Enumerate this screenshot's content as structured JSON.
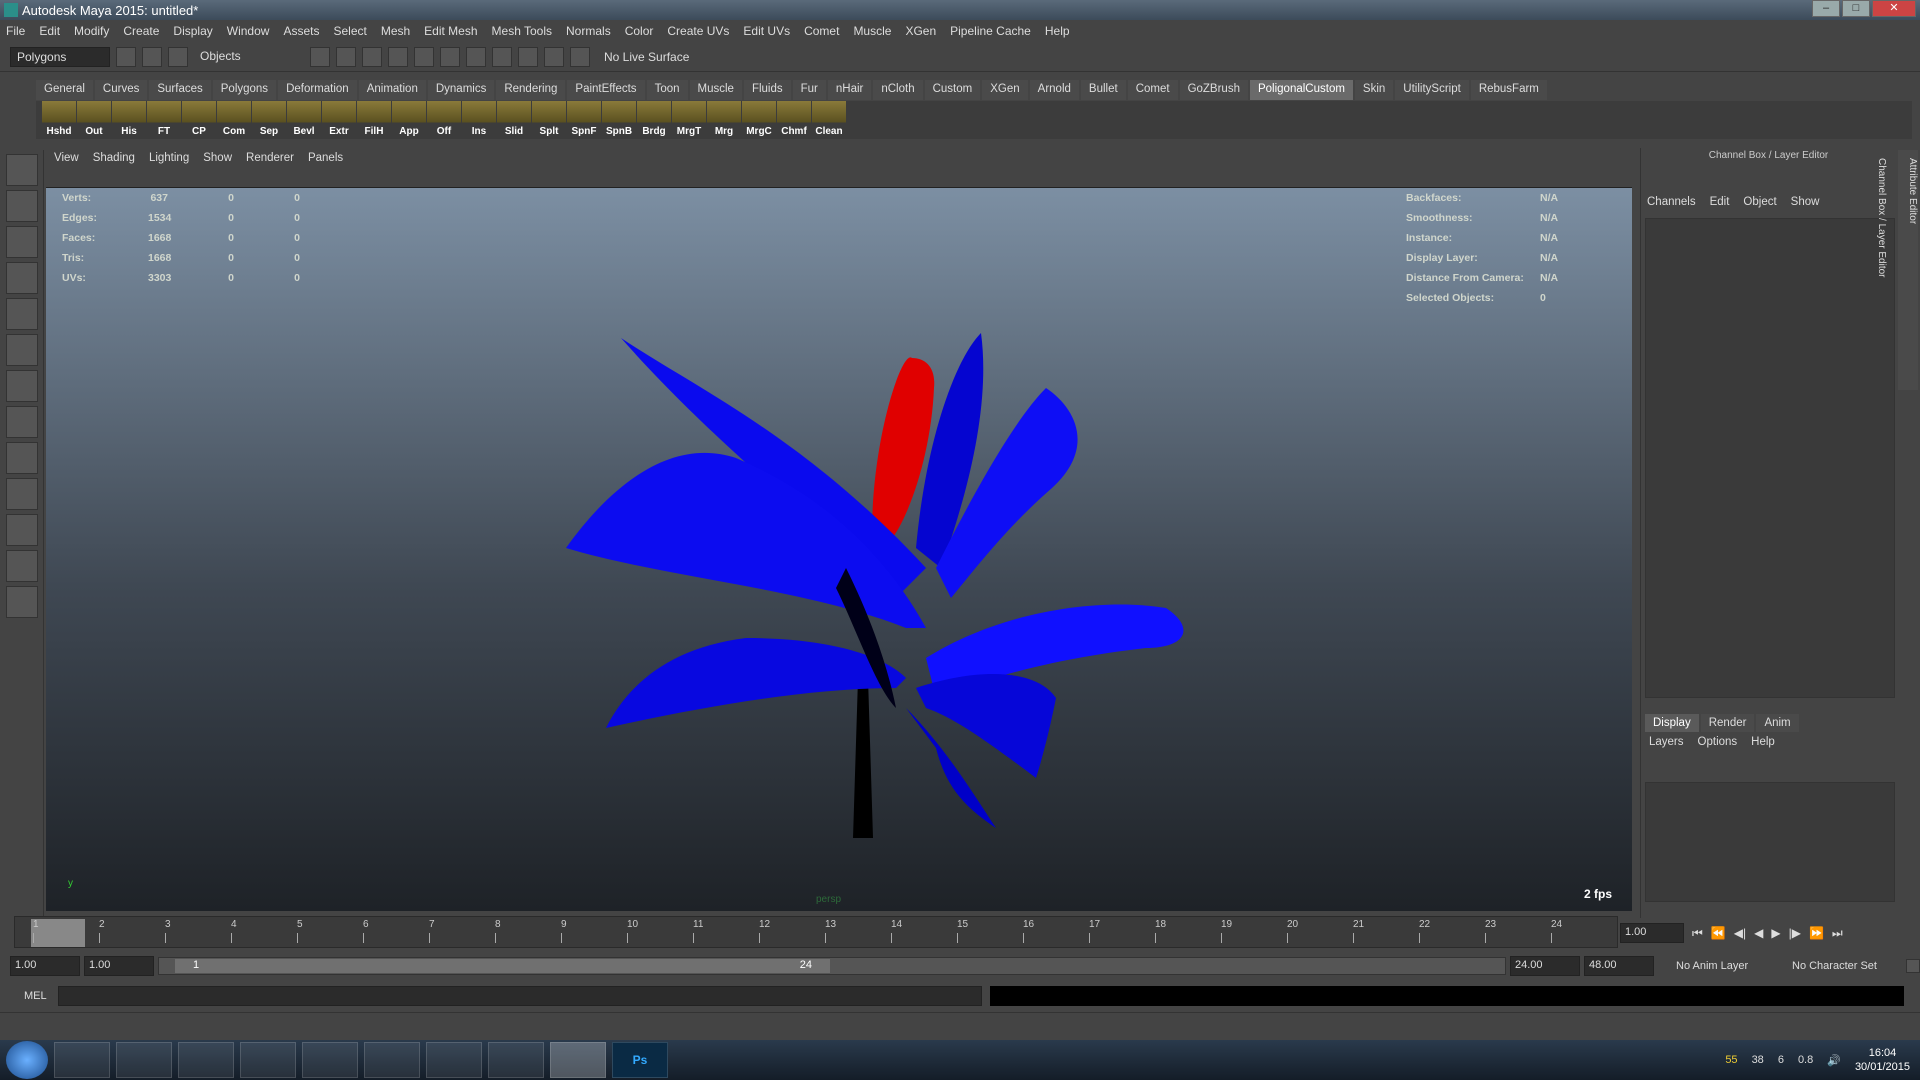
{
  "window": {
    "title": "Autodesk Maya 2015: untitled*"
  },
  "menubar": [
    "File",
    "Edit",
    "Modify",
    "Create",
    "Display",
    "Window",
    "Assets",
    "Select",
    "Mesh",
    "Edit Mesh",
    "Mesh Tools",
    "Normals",
    "Color",
    "Create UVs",
    "Edit UVs",
    "Comet",
    "Muscle",
    "XGen",
    "Pipeline Cache",
    "Help"
  ],
  "statusline": {
    "mode": "Polygons",
    "select_mode": "Objects",
    "live_surface": "No Live Surface"
  },
  "shelf_tabs": [
    "General",
    "Curves",
    "Surfaces",
    "Polygons",
    "Deformation",
    "Animation",
    "Dynamics",
    "Rendering",
    "PaintEffects",
    "Toon",
    "Muscle",
    "Fluids",
    "Fur",
    "nHair",
    "nCloth",
    "Custom",
    "XGen",
    "Arnold",
    "Bullet",
    "Comet",
    "GoZBrush",
    "PoligonalCustom",
    "Skin",
    "UtilityScript",
    "RebusFarm"
  ],
  "active_shelf_tab": "PoligonalCustom",
  "shelf_buttons": [
    "Hshd",
    "Out",
    "His",
    "FT",
    "CP",
    "Com",
    "Sep",
    "Bevl",
    "Extr",
    "FilH",
    "App",
    "Off",
    "Ins",
    "Slid",
    "Splt",
    "SpnF",
    "SpnB",
    "Brdg",
    "MrgT",
    "Mrg",
    "MrgC",
    "Chmf",
    "Clean"
  ],
  "panel_menu": [
    "View",
    "Shading",
    "Lighting",
    "Show",
    "Renderer",
    "Panels"
  ],
  "hud_left": [
    {
      "label": "Verts:",
      "v1": "637",
      "v2": "0",
      "v3": "0"
    },
    {
      "label": "Edges:",
      "v1": "1534",
      "v2": "0",
      "v3": "0"
    },
    {
      "label": "Faces:",
      "v1": "1668",
      "v2": "0",
      "v3": "0"
    },
    {
      "label": "Tris:",
      "v1": "1668",
      "v2": "0",
      "v3": "0"
    },
    {
      "label": "UVs:",
      "v1": "3303",
      "v2": "0",
      "v3": "0"
    }
  ],
  "hud_right": [
    {
      "label": "Backfaces:",
      "value": "N/A"
    },
    {
      "label": "Smoothness:",
      "value": "N/A"
    },
    {
      "label": "Instance:",
      "value": "N/A"
    },
    {
      "label": "Display Layer:",
      "value": "N/A"
    },
    {
      "label": "Distance From Camera:",
      "value": "N/A"
    },
    {
      "label": "Selected Objects:",
      "value": "0"
    }
  ],
  "viewport": {
    "fps": "2 fps",
    "camera": "persp",
    "axis_label": "y"
  },
  "channel_box": {
    "title": "Channel Box / Layer Editor",
    "menu": [
      "Channels",
      "Edit",
      "Object",
      "Show"
    ],
    "layer_tabs": [
      "Display",
      "Render",
      "Anim"
    ],
    "layer_menu": [
      "Layers",
      "Options",
      "Help"
    ]
  },
  "side_tabs": [
    "Attribute Editor",
    "Channel Box / Layer Editor"
  ],
  "timeline": {
    "ticks": [
      "1",
      "2",
      "3",
      "4",
      "5",
      "6",
      "7",
      "8",
      "9",
      "10",
      "11",
      "12",
      "13",
      "14",
      "15",
      "16",
      "17",
      "18",
      "19",
      "20",
      "21",
      "22",
      "23",
      "24"
    ],
    "current": "1",
    "current_field": "1.00"
  },
  "range": {
    "start": "1.00",
    "playback_start": "1.00",
    "thumb_start": "1",
    "thumb_end": "24",
    "playback_end": "24.00",
    "end": "48.00",
    "anim_layer": "No Anim Layer",
    "character_set": "No Character Set"
  },
  "mel_label": "MEL",
  "taskbar": {
    "ps_label": "Ps",
    "tray_numbers": [
      "55",
      "38",
      "6",
      "0.8"
    ],
    "time": "16:04",
    "date": "30/01/2015"
  }
}
